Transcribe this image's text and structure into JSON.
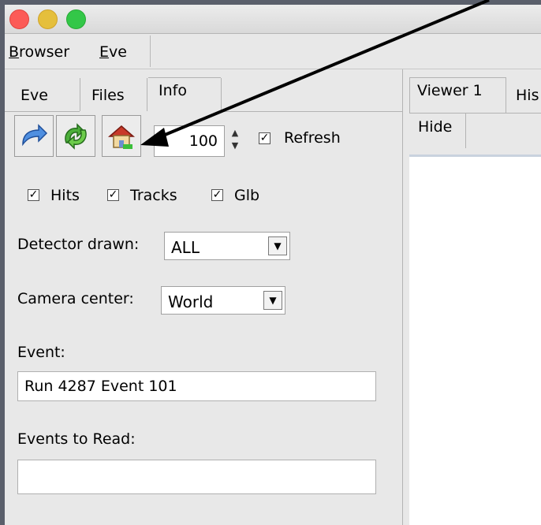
{
  "menubar": {
    "items": [
      {
        "label": "Browser",
        "mnemonic": "B",
        "rest": "rowser"
      },
      {
        "label": "Eve",
        "mnemonic": "E",
        "rest": "ve"
      }
    ]
  },
  "left_panel": {
    "tabs": [
      "Eve",
      "Files",
      "Info"
    ],
    "active_tab": "Info",
    "toolbar": {
      "icons": [
        "forward-arrow-icon",
        "refresh-arrows-icon",
        "home-icon"
      ],
      "spin_value": "100",
      "refresh_label": "Refresh",
      "refresh_checked": true
    },
    "checkboxes": [
      {
        "label": "Hits",
        "checked": true
      },
      {
        "label": "Tracks",
        "checked": true
      },
      {
        "label": "Glb",
        "checked": true
      }
    ],
    "detector": {
      "label": "Detector drawn:",
      "value": "ALL"
    },
    "camera": {
      "label": "Camera center:",
      "value": "World"
    },
    "event": {
      "label": "Event:",
      "value": "Run 4287 Event 101"
    },
    "events_to_read": {
      "label": "Events to Read:",
      "value": ""
    }
  },
  "right_panel": {
    "tabs": [
      "Viewer 1",
      "His"
    ],
    "hide_label": "Hide"
  },
  "colors": {
    "close": "#fc5b57",
    "minimize": "#e5bf3c",
    "maximize": "#33c748",
    "panel": "#e8e8e8",
    "desktop": "#5a5f6b"
  }
}
